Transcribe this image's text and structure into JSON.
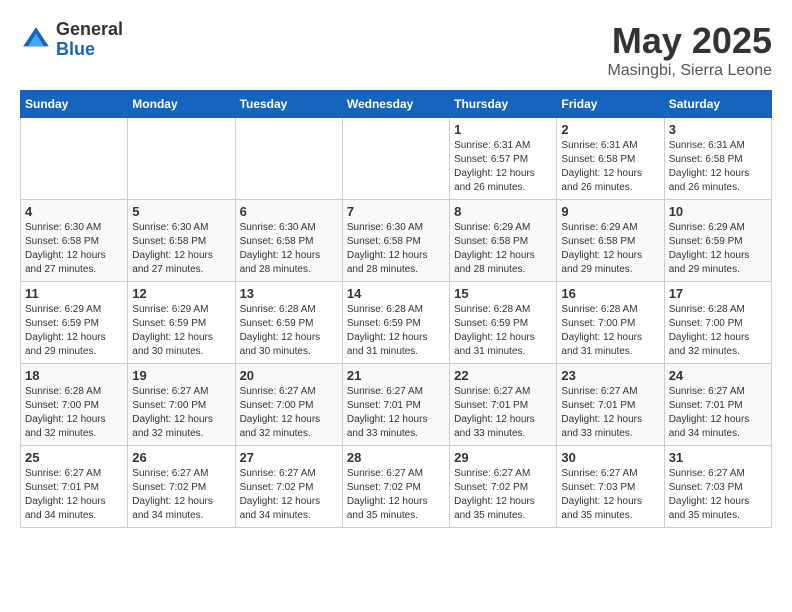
{
  "header": {
    "logo_general": "General",
    "logo_blue": "Blue",
    "month": "May 2025",
    "location": "Masingbi, Sierra Leone"
  },
  "weekdays": [
    "Sunday",
    "Monday",
    "Tuesday",
    "Wednesday",
    "Thursday",
    "Friday",
    "Saturday"
  ],
  "weeks": [
    [
      {
        "day": "",
        "empty": true
      },
      {
        "day": "",
        "empty": true
      },
      {
        "day": "",
        "empty": true
      },
      {
        "day": "",
        "empty": true
      },
      {
        "day": "1",
        "sunrise": "Sunrise: 6:31 AM",
        "sunset": "Sunset: 6:57 PM",
        "daylight": "Daylight: 12 hours and 26 minutes."
      },
      {
        "day": "2",
        "sunrise": "Sunrise: 6:31 AM",
        "sunset": "Sunset: 6:58 PM",
        "daylight": "Daylight: 12 hours and 26 minutes."
      },
      {
        "day": "3",
        "sunrise": "Sunrise: 6:31 AM",
        "sunset": "Sunset: 6:58 PM",
        "daylight": "Daylight: 12 hours and 26 minutes."
      }
    ],
    [
      {
        "day": "4",
        "sunrise": "Sunrise: 6:30 AM",
        "sunset": "Sunset: 6:58 PM",
        "daylight": "Daylight: 12 hours and 27 minutes."
      },
      {
        "day": "5",
        "sunrise": "Sunrise: 6:30 AM",
        "sunset": "Sunset: 6:58 PM",
        "daylight": "Daylight: 12 hours and 27 minutes."
      },
      {
        "day": "6",
        "sunrise": "Sunrise: 6:30 AM",
        "sunset": "Sunset: 6:58 PM",
        "daylight": "Daylight: 12 hours and 28 minutes."
      },
      {
        "day": "7",
        "sunrise": "Sunrise: 6:30 AM",
        "sunset": "Sunset: 6:58 PM",
        "daylight": "Daylight: 12 hours and 28 minutes."
      },
      {
        "day": "8",
        "sunrise": "Sunrise: 6:29 AM",
        "sunset": "Sunset: 6:58 PM",
        "daylight": "Daylight: 12 hours and 28 minutes."
      },
      {
        "day": "9",
        "sunrise": "Sunrise: 6:29 AM",
        "sunset": "Sunset: 6:58 PM",
        "daylight": "Daylight: 12 hours and 29 minutes."
      },
      {
        "day": "10",
        "sunrise": "Sunrise: 6:29 AM",
        "sunset": "Sunset: 6:59 PM",
        "daylight": "Daylight: 12 hours and 29 minutes."
      }
    ],
    [
      {
        "day": "11",
        "sunrise": "Sunrise: 6:29 AM",
        "sunset": "Sunset: 6:59 PM",
        "daylight": "Daylight: 12 hours and 29 minutes."
      },
      {
        "day": "12",
        "sunrise": "Sunrise: 6:29 AM",
        "sunset": "Sunset: 6:59 PM",
        "daylight": "Daylight: 12 hours and 30 minutes."
      },
      {
        "day": "13",
        "sunrise": "Sunrise: 6:28 AM",
        "sunset": "Sunset: 6:59 PM",
        "daylight": "Daylight: 12 hours and 30 minutes."
      },
      {
        "day": "14",
        "sunrise": "Sunrise: 6:28 AM",
        "sunset": "Sunset: 6:59 PM",
        "daylight": "Daylight: 12 hours and 31 minutes."
      },
      {
        "day": "15",
        "sunrise": "Sunrise: 6:28 AM",
        "sunset": "Sunset: 6:59 PM",
        "daylight": "Daylight: 12 hours and 31 minutes."
      },
      {
        "day": "16",
        "sunrise": "Sunrise: 6:28 AM",
        "sunset": "Sunset: 7:00 PM",
        "daylight": "Daylight: 12 hours and 31 minutes."
      },
      {
        "day": "17",
        "sunrise": "Sunrise: 6:28 AM",
        "sunset": "Sunset: 7:00 PM",
        "daylight": "Daylight: 12 hours and 32 minutes."
      }
    ],
    [
      {
        "day": "18",
        "sunrise": "Sunrise: 6:28 AM",
        "sunset": "Sunset: 7:00 PM",
        "daylight": "Daylight: 12 hours and 32 minutes."
      },
      {
        "day": "19",
        "sunrise": "Sunrise: 6:27 AM",
        "sunset": "Sunset: 7:00 PM",
        "daylight": "Daylight: 12 hours and 32 minutes."
      },
      {
        "day": "20",
        "sunrise": "Sunrise: 6:27 AM",
        "sunset": "Sunset: 7:00 PM",
        "daylight": "Daylight: 12 hours and 32 minutes."
      },
      {
        "day": "21",
        "sunrise": "Sunrise: 6:27 AM",
        "sunset": "Sunset: 7:01 PM",
        "daylight": "Daylight: 12 hours and 33 minutes."
      },
      {
        "day": "22",
        "sunrise": "Sunrise: 6:27 AM",
        "sunset": "Sunset: 7:01 PM",
        "daylight": "Daylight: 12 hours and 33 minutes."
      },
      {
        "day": "23",
        "sunrise": "Sunrise: 6:27 AM",
        "sunset": "Sunset: 7:01 PM",
        "daylight": "Daylight: 12 hours and 33 minutes."
      },
      {
        "day": "24",
        "sunrise": "Sunrise: 6:27 AM",
        "sunset": "Sunset: 7:01 PM",
        "daylight": "Daylight: 12 hours and 34 minutes."
      }
    ],
    [
      {
        "day": "25",
        "sunrise": "Sunrise: 6:27 AM",
        "sunset": "Sunset: 7:01 PM",
        "daylight": "Daylight: 12 hours and 34 minutes."
      },
      {
        "day": "26",
        "sunrise": "Sunrise: 6:27 AM",
        "sunset": "Sunset: 7:02 PM",
        "daylight": "Daylight: 12 hours and 34 minutes."
      },
      {
        "day": "27",
        "sunrise": "Sunrise: 6:27 AM",
        "sunset": "Sunset: 7:02 PM",
        "daylight": "Daylight: 12 hours and 34 minutes."
      },
      {
        "day": "28",
        "sunrise": "Sunrise: 6:27 AM",
        "sunset": "Sunset: 7:02 PM",
        "daylight": "Daylight: 12 hours and 35 minutes."
      },
      {
        "day": "29",
        "sunrise": "Sunrise: 6:27 AM",
        "sunset": "Sunset: 7:02 PM",
        "daylight": "Daylight: 12 hours and 35 minutes."
      },
      {
        "day": "30",
        "sunrise": "Sunrise: 6:27 AM",
        "sunset": "Sunset: 7:03 PM",
        "daylight": "Daylight: 12 hours and 35 minutes."
      },
      {
        "day": "31",
        "sunrise": "Sunrise: 6:27 AM",
        "sunset": "Sunset: 7:03 PM",
        "daylight": "Daylight: 12 hours and 35 minutes."
      }
    ]
  ]
}
